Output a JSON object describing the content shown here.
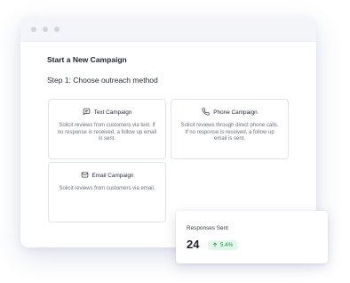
{
  "window": {
    "title": "Start a New Campaign",
    "step": "Step 1: Choose outreach method"
  },
  "cards": {
    "text": {
      "title": "Text Campaign",
      "description": "Solicit reviews from customers via text. If no response is received, a follow up email is sent.",
      "icon": "message-square-icon"
    },
    "phone": {
      "title": "Phone Campaign",
      "description": "Solicit reviews through direct phone calls. If no response is received, a follow up email is sent.",
      "icon": "phone-icon"
    },
    "email": {
      "title": "Email Campaign",
      "description": "Solicit reviews from customers via email.",
      "icon": "mail-icon"
    }
  },
  "stat": {
    "label": "Responses Sent",
    "value": "24",
    "change": "5.4%",
    "change_icon": "arrow-up-icon"
  },
  "colors": {
    "badge_bg": "#e3f6ea",
    "badge_text": "#1f8a4c"
  }
}
